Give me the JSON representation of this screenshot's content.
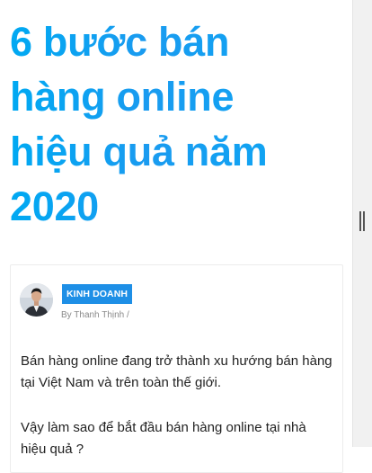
{
  "article": {
    "title_lines": [
      "6 bước bán",
      "hàng online",
      "hiệu quả năm",
      "2020"
    ],
    "category": "KINH DOANH",
    "byline": "By Thanh Thịnh /",
    "paragraphs": [
      "Bán hàng online đang trở thành xu hướng bán hàng tại Việt Nam và trên toàn thế giới.",
      "Vậy làm sao để bắt đầu bán hàng online tại nhà hiệu quả ?"
    ]
  },
  "colors": {
    "title": "#00a9f2",
    "badge": "#1e8fe6"
  },
  "icons": {
    "scrollbar": "grip-icon"
  }
}
